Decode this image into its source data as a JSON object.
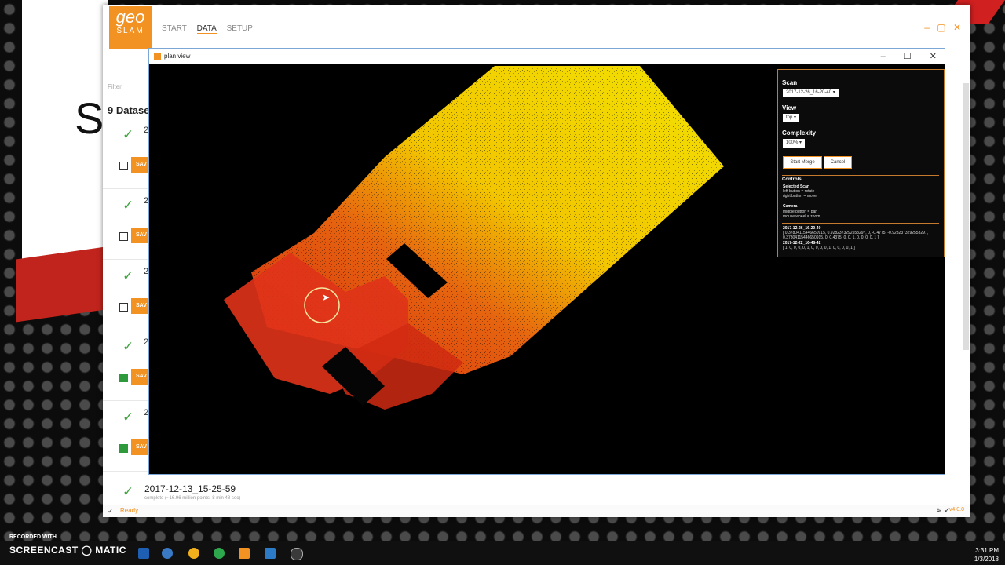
{
  "app": {
    "logo_top": "geo",
    "logo_bottom": "SLAM",
    "nav": [
      "START",
      "DATA",
      "SETUP"
    ],
    "active_nav": "DATA",
    "window_controls": {
      "minimize": "–",
      "maximize": "▢",
      "close": "✕"
    },
    "filter_label": "Filter",
    "datasets_heading": "9 Datase",
    "big_letter": "S",
    "dataset_rows": [
      {
        "prefix": "2",
        "saved": false
      },
      {
        "prefix": "2",
        "saved": false
      },
      {
        "prefix": "2",
        "saved": false
      },
      {
        "prefix": "2",
        "saved": true
      },
      {
        "prefix": "2",
        "saved": true
      }
    ],
    "save_label": "SAV",
    "last_dataset": {
      "name": "2017-12-13_15-25-59",
      "subtitle": "complete (~16.96 million points, 8 min 48 sec)"
    },
    "status": "Ready",
    "version": "v4.0.0",
    "status_icons": {
      "wifi": "wifi-icon",
      "check": "check-icon"
    }
  },
  "plan_view": {
    "title": "plan view",
    "controls": {
      "minimize": "–",
      "maximize": "☐",
      "close": "✕"
    },
    "panel": {
      "scan_label": "Scan",
      "scan_value": "2017-12-26_16-20-40",
      "view_label": "View",
      "view_value": "top",
      "complexity_label": "Complexity",
      "complexity_value": "100%",
      "start_merge": "Start Merge",
      "cancel": "Cancel",
      "controls_heading": "Controls",
      "selected_scan": "Selected Scan",
      "left_button": "left button = rotate",
      "right_button": "right button = move",
      "camera": "Camera",
      "middle_button": "middle button = pan",
      "mouse_wheel": "mouse wheel = zoom",
      "matrix_name_1": "2017-12-26_16-20-40",
      "matrix_1": "[ 0.37804115446650915, 0.9282373292553297, 0, -0.4775, -0.9282373292553297, 0.37804115446650915, 0, 0.4375, 0, 0, 1, 0, 0, 0, 0, 1 ]",
      "matrix_name_2": "2017-12-22_16-48-42",
      "matrix_2": "[ 1, 0, 0, 0, 0, 1, 0, 0, 0, 0, 1, 0, 0, 0, 0, 1 ]"
    }
  },
  "taskbar": {
    "recorded_with": "RECORDED WITH",
    "brand": "SCREENCAST ◯ MATIC",
    "time": "3:31 PM",
    "date": "1/3/2018"
  },
  "colors": {
    "accent": "#f29222",
    "pointcloud_near": "#ffee00",
    "pointcloud_far": "#e02a10",
    "check": "#3fa33f"
  }
}
